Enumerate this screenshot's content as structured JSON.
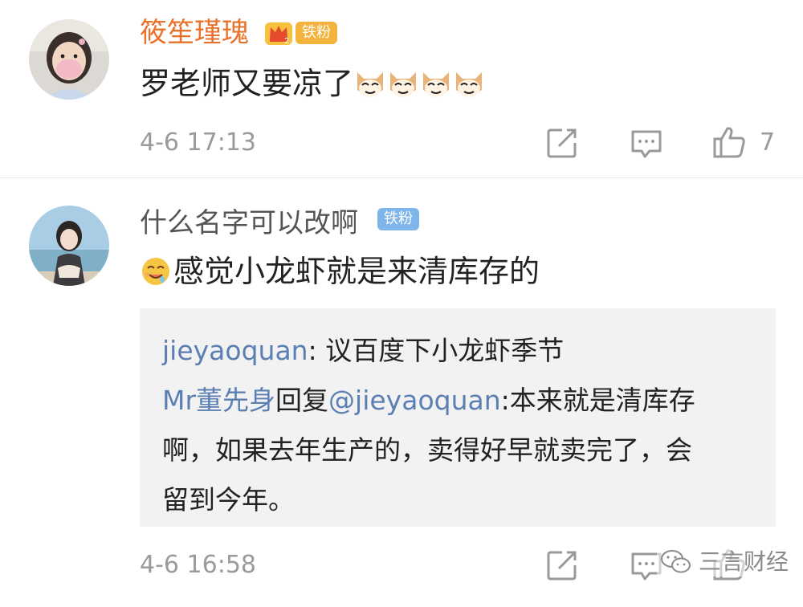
{
  "comments": [
    {
      "username": "筱笙瑾瑰",
      "level_icon": "crown-icon",
      "fan_badge": "铁粉",
      "text": "罗老师又要凉了",
      "emoji_count": 4,
      "emoji_icon": "cat-face-emoji",
      "time": "4-6 17:13",
      "like_count": "7",
      "actions": [
        "share-icon",
        "reply-icon",
        "like-icon"
      ]
    },
    {
      "username": "什么名字可以改啊",
      "fan_badge": "铁粉",
      "emoji_icon": "drooling-face-emoji",
      "text": "感觉小龙虾就是来清库存的",
      "replies": [
        {
          "user": "jieyaoquan",
          "text": ": 议百度下小龙虾季节"
        },
        {
          "user": "Mr董先身",
          "reply_word": "回复",
          "mention": "@jieyaoquan",
          "text_line1": ":本来就是清库存",
          "text_line2": "啊，如果去年生产的，卖得好早就卖完了，会",
          "text_line3": "留到今年。"
        }
      ],
      "time": "4-6 16:58",
      "actions": [
        "share-icon",
        "reply-icon",
        "like-icon"
      ]
    }
  ],
  "watermark": {
    "icon": "wechat-icon",
    "text": "三言财经"
  },
  "colors": {
    "vip_name": "#e8722a",
    "name": "#555555",
    "link": "#5b7fb3",
    "meta": "#9a9a9a",
    "reply_bg": "#f2f2f2"
  }
}
